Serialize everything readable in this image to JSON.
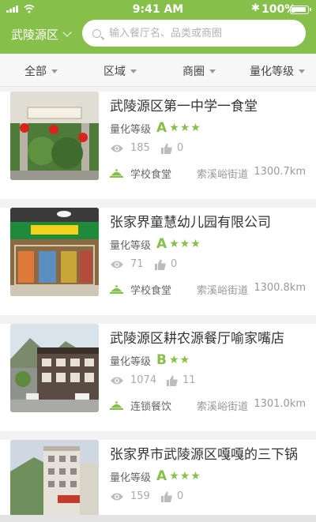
{
  "status_bar": {
    "time": "9:41 AM",
    "battery": "100%"
  },
  "header": {
    "city": "武陵源区",
    "search_placeholder": "输入餐厅名、品类或商圈"
  },
  "filters": [
    "全部",
    "区域",
    "商圈",
    "量化等级"
  ],
  "colors": {
    "brand": "#86c04a"
  },
  "restaurants": [
    {
      "name": "武陵源区第一中学一食堂",
      "level_label": "量化等级",
      "grade": "A",
      "stars": 3,
      "views": "185",
      "likes": "0",
      "category": "学校食堂",
      "street": "索溪峪街道",
      "distance": "1300.7km"
    },
    {
      "name": "张家界童慧幼儿园有限公司",
      "level_label": "量化等级",
      "grade": "A",
      "stars": 3,
      "views": "71",
      "likes": "0",
      "category": "学校食堂",
      "street": "索溪峪街道",
      "distance": "1300.8km"
    },
    {
      "name": "武陵源区耕农源餐厅喻家嘴店",
      "level_label": "量化等级",
      "grade": "B",
      "stars": 2,
      "views": "1074",
      "likes": "11",
      "category": "连锁餐饮",
      "street": "索溪峪街道",
      "distance": "1301.0km"
    },
    {
      "name": "张家界市武陵源区嘎嘎的三下锅",
      "level_label": "量化等级",
      "grade": "A",
      "stars": 3,
      "views": "159",
      "likes": "0"
    }
  ]
}
